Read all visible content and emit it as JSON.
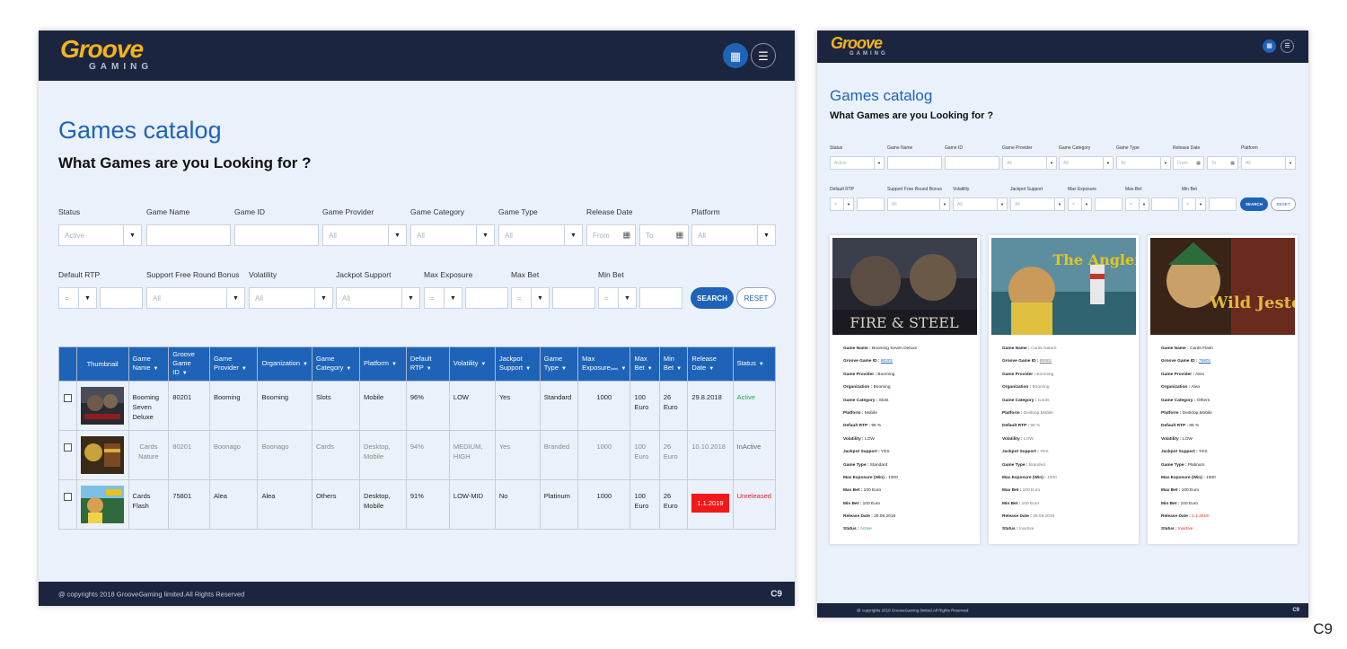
{
  "brand": {
    "word": "Groove",
    "sub": "GAMING"
  },
  "header": {
    "grid_icon": "grid-icon",
    "list_icon": "list-icon"
  },
  "page": {
    "title": "Games catalog",
    "subtitle": "What Games are you Looking for ?"
  },
  "filters": {
    "status": {
      "label": "Status",
      "value": "Active"
    },
    "game_name": {
      "label": "Game Name",
      "value": ""
    },
    "game_id": {
      "label": "Game ID",
      "value": ""
    },
    "game_provider": {
      "label": "Game Provider",
      "value": "All"
    },
    "game_category": {
      "label": "Game Category",
      "value": "All"
    },
    "game_type": {
      "label": "Game Type",
      "value": "All"
    },
    "release_date": {
      "label": "Release Date",
      "from": "From",
      "to": "To"
    },
    "platform": {
      "label": "Platform",
      "value": "All"
    },
    "default_rtp": {
      "label": "Default RTP",
      "op": "=",
      "value": ""
    },
    "free_round": {
      "label": "Support Free Round Bonus",
      "value": "All"
    },
    "volatility": {
      "label": "Volatility",
      "value": "All"
    },
    "jackpot": {
      "label": "Jackpot Support",
      "value": "All"
    },
    "max_exposure": {
      "label": "Max Exposure",
      "op": "=",
      "value": ""
    },
    "max_bet": {
      "label": "Max Bet",
      "op": "=",
      "value": ""
    },
    "min_bet": {
      "label": "Min Bet",
      "op": "=",
      "value": ""
    },
    "search_label": "SEARCH",
    "reset_label": "RESET"
  },
  "table": {
    "columns": [
      "Thumbnail",
      "Game Name",
      "Groove Game ID",
      "Game Provider",
      "Organization",
      "Game Category",
      "Platform",
      "Default RTP",
      "Volatility",
      "Jackpot Support",
      "Game Type",
      "Max Exposure",
      "(win)",
      "Max Bet",
      "Min Bet",
      "Release Date",
      "Status"
    ],
    "rows": [
      {
        "name": "Booming Seven Deluxe",
        "id": "80201",
        "provider": "Booming",
        "org": "Booming",
        "category": "Slots",
        "platform": "Mobile",
        "rtp": "96%",
        "volatility": "LOW",
        "jackpot": "Yes",
        "type": "Standard",
        "exposure": "1000",
        "max_bet": "100 Euro",
        "min_bet": "26 Euro",
        "release": "29.8.2018",
        "status": "Active"
      },
      {
        "name": "Cards Nature",
        "id": "80201",
        "provider": "Boonago",
        "org": "Boonago",
        "category": "Cards",
        "platform": "Desktop, Mobile",
        "rtp": "94%",
        "volatility": "MEDIUM, HIGH",
        "jackpot": "Yes",
        "type": "Branded",
        "exposure": "1000",
        "max_bet": "100 Euro",
        "min_bet": "26 Euro",
        "release": "10.10.2018",
        "status": "InActive"
      },
      {
        "name": "Cards Flash",
        "id": "75801",
        "provider": "Alea",
        "org": "Alea",
        "category": "Others",
        "platform": "Desktop, Mobile",
        "rtp": "91%",
        "volatility": "LOW-MID",
        "jackpot": "No",
        "type": "Platinum",
        "exposure": "1000",
        "max_bet": "100 Euro",
        "min_bet": "26 Euro",
        "release": "1.1.2019",
        "status": "Unreleased"
      }
    ]
  },
  "footer": {
    "copyright": "@ copyrights 2018 GrooveGaming limited.All Rights Reserved",
    "mark": "C9"
  },
  "cards": {
    "keys": [
      "Game Name :",
      "Groove Game ID :",
      "Game Provider :",
      "Organization :",
      "Game Category :",
      "Platform :",
      "Default RTP :",
      "Volatility :",
      "Jackpot Support :",
      "Game Type :",
      "Max Exposure (Win) :",
      "Max Bet :",
      "Min Bet :",
      "Release Date :",
      "Status :"
    ],
    "items": [
      {
        "img_text": "FIRE & STEEL",
        "vals": [
          "Booming Seven Deluxe",
          "80201",
          "Booming",
          "Booming",
          "Slots",
          "Mobile",
          "96 %",
          "LOW",
          "YES",
          "Standard",
          "1000",
          "100 Euro",
          "100 Euro",
          "29.08.2018",
          "Active"
        ]
      },
      {
        "img_text": "The Angler",
        "vals": [
          "Cards Nature",
          "85901",
          "Booming",
          "Booming",
          "Cards",
          "Desktop,Mobile",
          "96 %",
          "LOW",
          "YES",
          "Branded",
          "1000",
          "100 Euro",
          "100 Euro",
          "29.08.2018",
          "Inactive"
        ]
      },
      {
        "img_text": "Wild Jester",
        "vals": [
          "Cards Flash",
          "75801",
          "Alea",
          "Alea",
          "Others",
          "Desktop,Mobile",
          "96 %",
          "LOW",
          "YES",
          "Platinum",
          "1000",
          "100 Euro",
          "100 Euro",
          "1.1.2019",
          "Inactive"
        ]
      }
    ]
  },
  "corner_mark": "C9",
  "colors": {
    "navy": "#1b2540",
    "brand_blue": "#1e63b8",
    "bg": "#eaf1fb",
    "active": "#27a844",
    "red": "#e21b1b",
    "logo_yellow": "#f4b41a"
  }
}
